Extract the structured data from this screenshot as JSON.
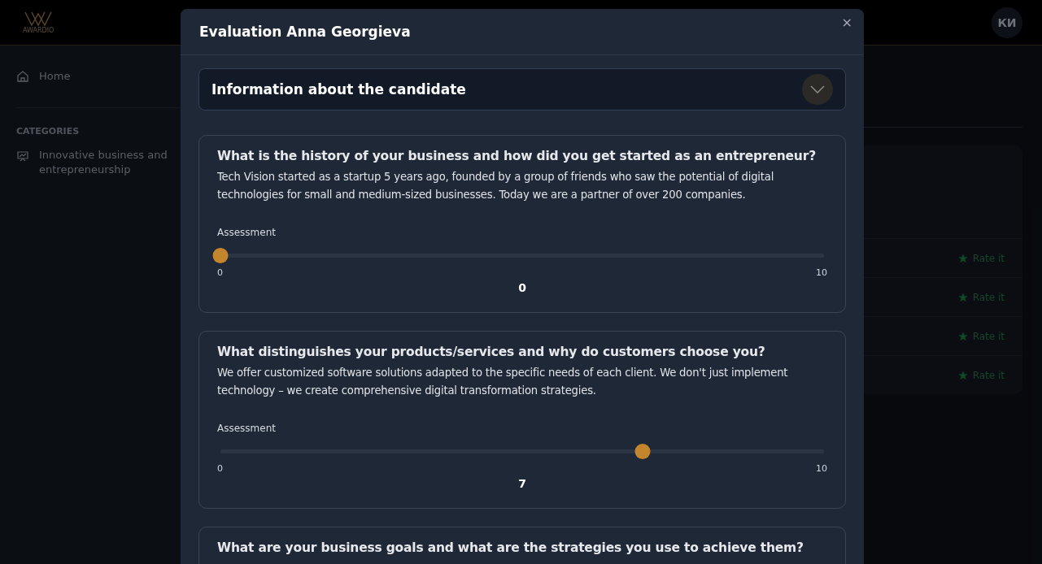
{
  "app": {
    "logo_text": "AWARDIO",
    "avatar": "КИ"
  },
  "sidebar": {
    "items": [
      {
        "label": "Home",
        "selected": false
      }
    ],
    "section_title": "CATEGORIES",
    "categories": [
      {
        "label": "Innovative business and entrepreneurship",
        "selected": false
      }
    ]
  },
  "table": {
    "rows": [
      {
        "action": "Rate it"
      },
      {
        "action": "Rate it"
      },
      {
        "action": "Rate it"
      },
      {
        "action": "Rate it"
      }
    ]
  },
  "modal": {
    "title": "Evaluation Anna Georgieva",
    "close": "×",
    "candidate_section": {
      "title": "Information about the candidate",
      "expanded": false
    },
    "questions": [
      {
        "question": "What is the history of your business and how did you get started as an entrepreneur?",
        "answer": "Tech Vision started as a startup 5 years ago, founded by a group of friends who saw the potential of digital technologies for small and medium-sized businesses. Today we are a partner of over 200 companies.",
        "label": "Assessment",
        "level": 0,
        "min": "0",
        "max": "10",
        "value": "0"
      },
      {
        "question": "What distinguishes your products/services and why do customers choose you?",
        "answer": "We offer customized software solutions adapted to the specific needs of each client. We don't just implement technology – we create comprehensive digital transformation strategies.",
        "label": "Assessment",
        "level": 0.7,
        "min": "0",
        "max": "10",
        "value": "7"
      },
      {
        "question": "What are your business goals and what are the strategies you use to achieve them?"
      }
    ]
  }
}
